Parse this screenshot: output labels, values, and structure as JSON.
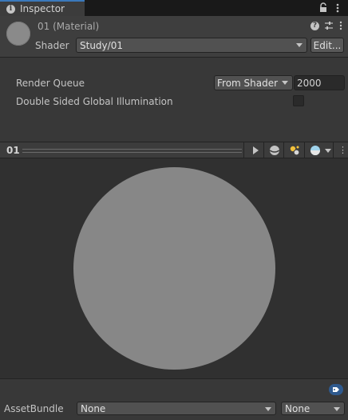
{
  "tab": {
    "label": "Inspector",
    "info_icon": "info-icon"
  },
  "header": {
    "title": "01 (Material)",
    "shader_label": "Shader",
    "shader_value": "Study/01",
    "edit_label": "Edit...",
    "help_glyph": "?",
    "kebab_glyph": "⋮"
  },
  "properties": {
    "render_queue_label": "Render Queue",
    "render_queue_mode": "From Shader",
    "render_queue_value": "2000",
    "dsgi_label": "Double Sided Global Illumination",
    "dsgi_checked": false
  },
  "preview": {
    "name": "01",
    "kebab_glyph": "⋮",
    "sphere_color": "#878787"
  },
  "footer": {
    "assetbundle_label": "AssetBundle",
    "assetbundle_value": "None",
    "variant_value": "None"
  },
  "colors": {
    "accent": "#3a79bb",
    "panel": "#383838",
    "tag": "#2f5a8e"
  }
}
